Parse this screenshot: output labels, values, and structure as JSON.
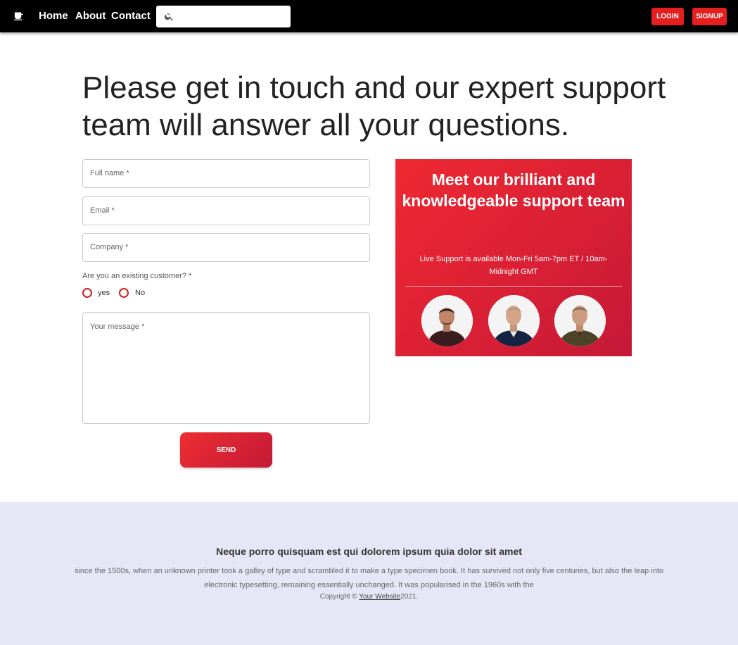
{
  "nav": {
    "logo_icon": "coffee-icon",
    "links": [
      "Home",
      "About",
      "Contact"
    ],
    "search": {
      "icon": "search-icon",
      "placeholder": "",
      "value": ""
    },
    "login_label": "LOGIN",
    "signup_label": "SIGNUP",
    "button_color": "#e3201f"
  },
  "page": {
    "heading": "Please get in touch and our expert support team will answer all your questions."
  },
  "form": {
    "full_name_label": "Full name *",
    "email_label": "Email *",
    "company_label": "Company *",
    "customer_question": "Are you an existing customer? *",
    "radio_yes": "yes",
    "radio_no": "No",
    "message_label": "Your message *",
    "send_label": "SEND"
  },
  "support_card": {
    "title": "Meet our brilliant and knowledgeable support team",
    "availability": "Live Support is available Mon-Fri 5am-7pm ET / 10am-Midnight GMT",
    "avatar_count": 3,
    "gradient_start": "#ee2931",
    "gradient_end": "#c41838"
  },
  "footer": {
    "title": "Neque porro quisquam est qui dolorem ipsum quia dolor sit amet",
    "text": "since the 1500s, when an unknown printer took a galley of type and scrambled it to make a type specimen book. It has survived not only five centuries, but also the leap into electronic typesetting, remaining essentially unchanged. It was popularised in the 1960s with the",
    "copyright_prefix": "Copyright © ",
    "copyright_link": "Your Website",
    "copyright_suffix": "2021.",
    "background": "#e6e6f7"
  }
}
